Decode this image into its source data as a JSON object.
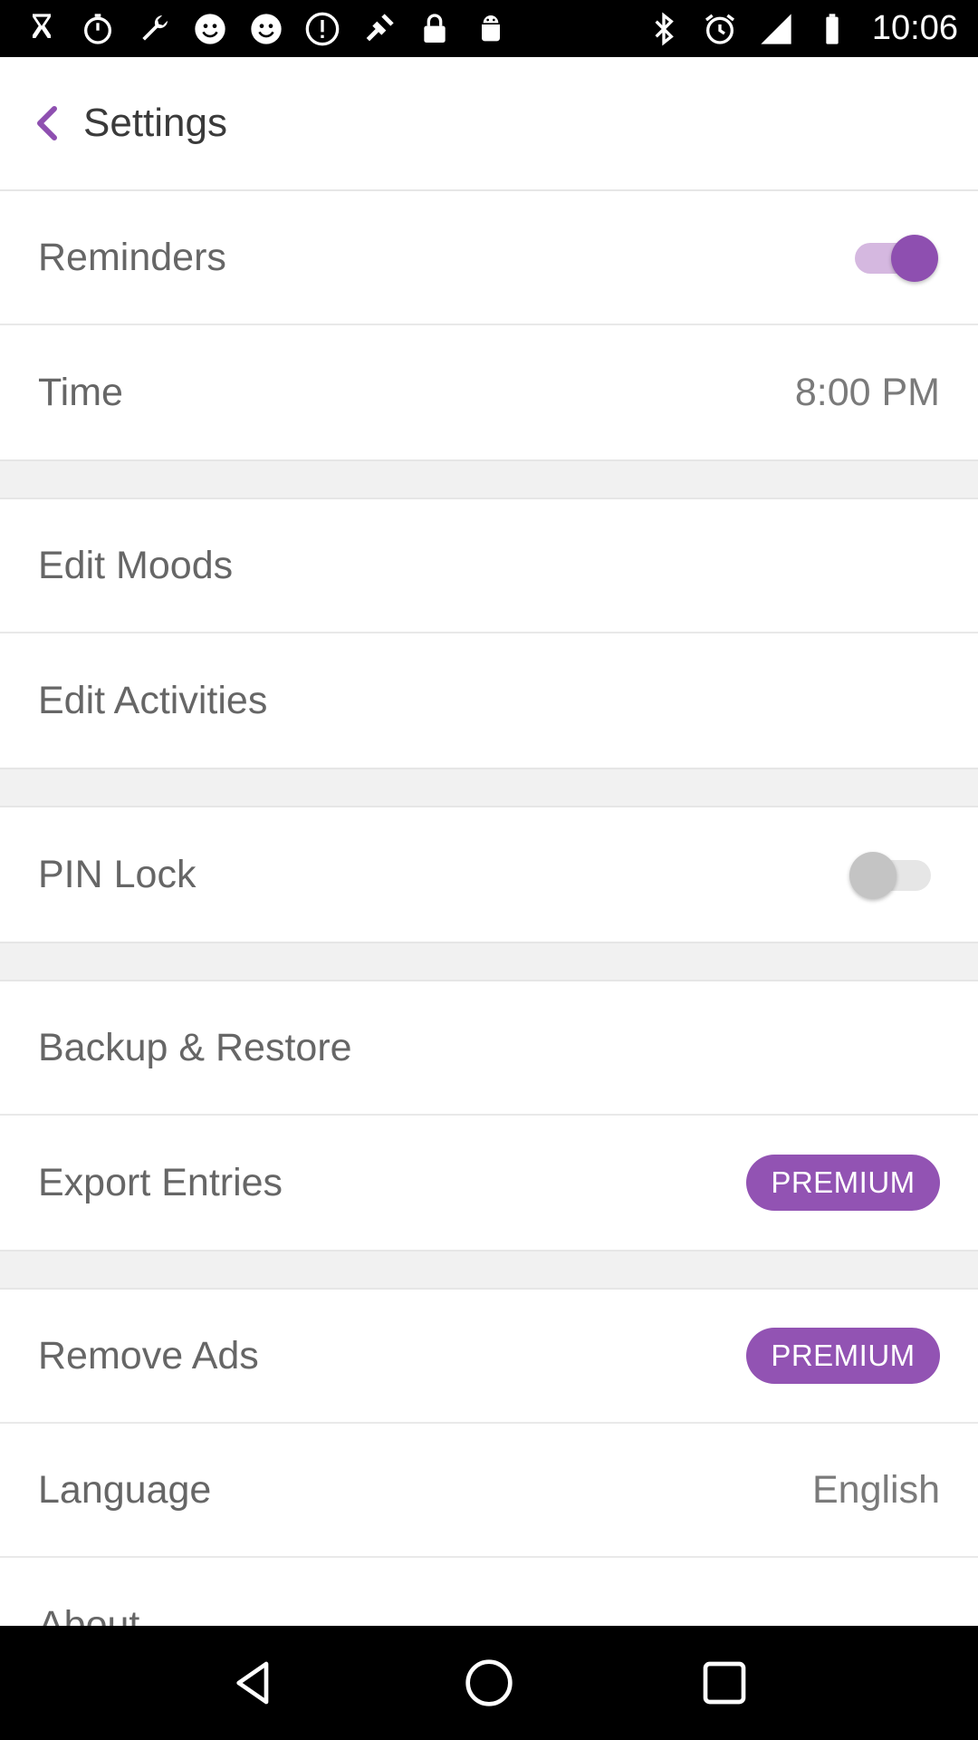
{
  "status_bar": {
    "time": "10:06",
    "left_icons": [
      "hourglass-icon",
      "stopwatch-icon",
      "wrench-icon",
      "smiley-icon",
      "smiley-icon",
      "alert-icon",
      "fake-gps-icon",
      "lock-icon",
      "android-icon"
    ],
    "right_icons": [
      "bluetooth-icon",
      "alarm-icon",
      "signal-icon",
      "battery-icon"
    ]
  },
  "header": {
    "title": "Settings",
    "accent_color": "#8e4fb0"
  },
  "settings": {
    "reminders": {
      "label": "Reminders",
      "enabled": true
    },
    "time": {
      "label": "Time",
      "value": "8:00 PM"
    },
    "edit_moods": {
      "label": "Edit Moods"
    },
    "edit_activities": {
      "label": "Edit Activities"
    },
    "pin_lock": {
      "label": "PIN Lock",
      "enabled": false
    },
    "backup_restore": {
      "label": "Backup & Restore"
    },
    "export_entries": {
      "label": "Export Entries",
      "badge": "PREMIUM"
    },
    "remove_ads": {
      "label": "Remove Ads",
      "badge": "PREMIUM"
    },
    "language": {
      "label": "Language",
      "value": "English"
    },
    "about": {
      "label": "About"
    }
  },
  "nav_bar": {
    "buttons": [
      "back-triangle-icon",
      "home-circle-icon",
      "recents-square-icon"
    ]
  }
}
